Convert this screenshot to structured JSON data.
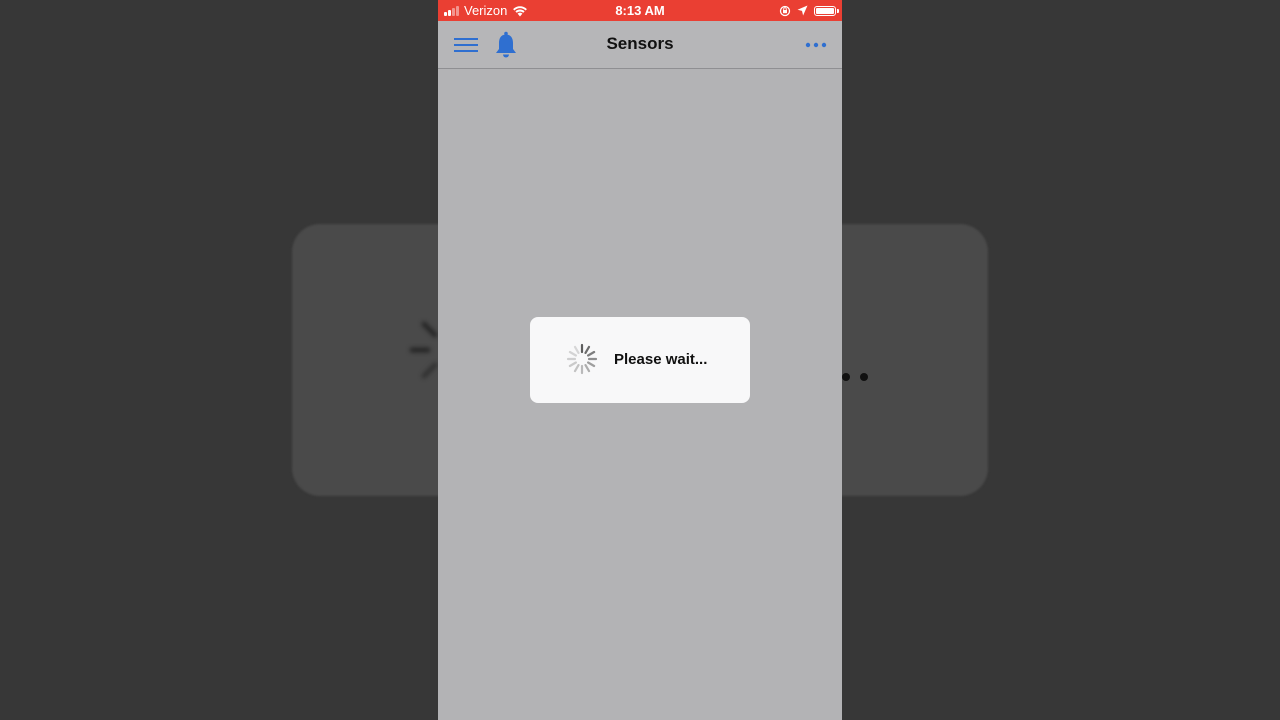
{
  "status_bar": {
    "carrier": "Verizon",
    "time": "8:13 AM",
    "signal_bars_active": 2,
    "signal_bars_total": 4,
    "battery_level": 1.0,
    "color": "#ea3f33"
  },
  "nav": {
    "title": "Sensors",
    "menu_icon": "hamburger-menu-icon",
    "bell_icon": "bell-icon",
    "more_icon": "more-horizontal-icon",
    "accent": "#2f6fd0"
  },
  "hud": {
    "message": "Please wait..."
  }
}
